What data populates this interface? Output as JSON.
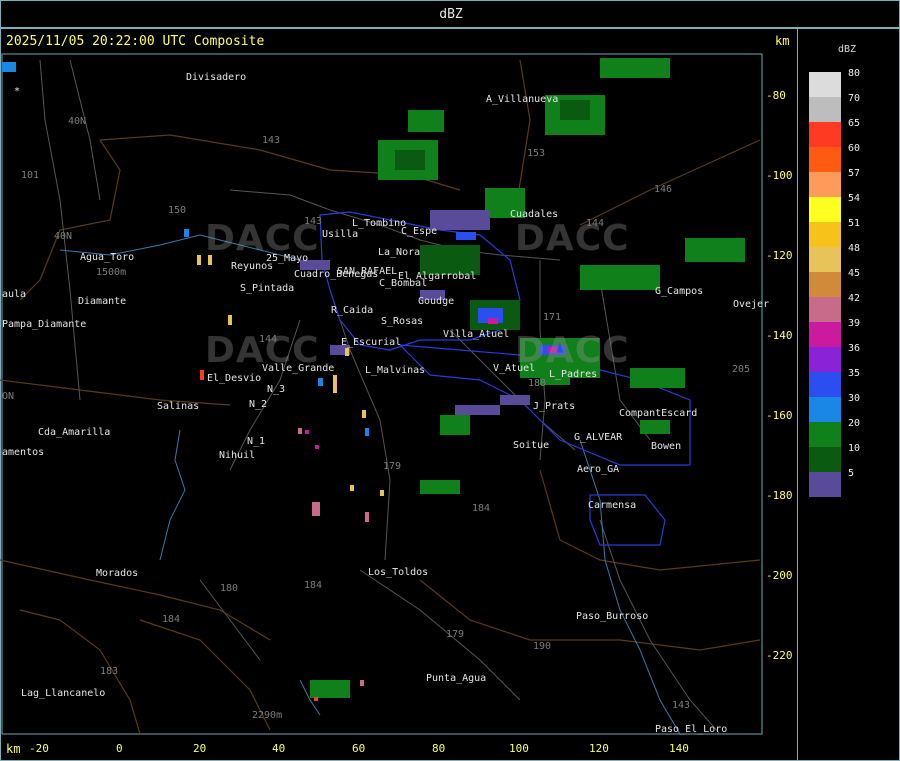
{
  "header": {
    "title": "dBZ"
  },
  "map": {
    "timestamp": "2025/11/05 20:22:00 UTC Composite",
    "km_label_top": "km",
    "km_label_bottom": "km",
    "y_ticks": [
      "-80",
      "-100",
      "-120",
      "-140",
      "-160",
      "-180",
      "-200",
      "-220"
    ],
    "x_ticks": [
      "-20",
      "0",
      "20",
      "40",
      "60",
      "80",
      "100",
      "120",
      "140"
    ],
    "watermark": "DACC",
    "places": [
      {
        "name": "Divisadero"
      },
      {
        "name": "A_Villanueva"
      },
      {
        "name": "Cuadales"
      },
      {
        "name": "L_Tombino"
      },
      {
        "name": "Usilla"
      },
      {
        "name": "C_Espe"
      },
      {
        "name": "Agua_Toro"
      },
      {
        "name": "Reyunos"
      },
      {
        "name": "25_Mayo"
      },
      {
        "name": "La_Nora"
      },
      {
        "name": "Cuadro_Benegas"
      },
      {
        "name": "SAN_RAFAEL"
      },
      {
        "name": "El_Algarrobal"
      },
      {
        "name": "Goudge"
      },
      {
        "name": "Villa_Atuel"
      },
      {
        "name": "G_Campos"
      },
      {
        "name": "Ovejer"
      },
      {
        "name": "Pampa_Diamante"
      },
      {
        "name": "S_Pintada"
      },
      {
        "name": "C_Bombal"
      },
      {
        "name": "R_Caida"
      },
      {
        "name": "S_Rosas"
      },
      {
        "name": "E_Escurial"
      },
      {
        "name": "L_Malvinas"
      },
      {
        "name": "V_Atuel"
      },
      {
        "name": "L_Padres"
      },
      {
        "name": "El_Desvio"
      },
      {
        "name": "Valle_Grande"
      },
      {
        "name": "N_3"
      },
      {
        "name": "N_2"
      },
      {
        "name": "N_1"
      },
      {
        "name": "Salinas"
      },
      {
        "name": "J_Prats"
      },
      {
        "name": "CompantEscard"
      },
      {
        "name": "Cda_Amarilla"
      },
      {
        "name": "Nihuil"
      },
      {
        "name": "G_ALVEAR"
      },
      {
        "name": "Bowen"
      },
      {
        "name": "Soitue"
      },
      {
        "name": "Aero_GA"
      },
      {
        "name": "Carmensa"
      },
      {
        "name": "Morados"
      },
      {
        "name": "Los_Toldos"
      },
      {
        "name": "Paso_Burroso"
      },
      {
        "name": "Punta_Agua"
      },
      {
        "name": "Lag_Llancanelo"
      },
      {
        "name": "Paso_El_Loro"
      },
      {
        "name": "aula"
      },
      {
        "name": "amentos"
      },
      {
        "name": "Diamante"
      },
      {
        "name": "*"
      }
    ],
    "roads": [
      "143",
      "40N",
      "101",
      "150",
      "143",
      "153",
      "146",
      "144",
      "40N",
      "144",
      "171",
      "188",
      "179",
      "184",
      "180",
      "184",
      "184",
      "183",
      "179",
      "190",
      "143",
      "205",
      "1500m",
      "2290m",
      "ON"
    ]
  },
  "legend": {
    "title": "dBZ",
    "levels": [
      {
        "label": "80",
        "color": "#dcdcdc"
      },
      {
        "label": "70",
        "color": "#bdbdbd"
      },
      {
        "label": "65",
        "color": "#ff3a22"
      },
      {
        "label": "60",
        "color": "#ff5a12"
      },
      {
        "label": "57",
        "color": "#ff9a5a"
      },
      {
        "label": "54",
        "color": "#ffff20"
      },
      {
        "label": "51",
        "color": "#f7c21a"
      },
      {
        "label": "48",
        "color": "#e8c35a"
      },
      {
        "label": "45",
        "color": "#d08a3a"
      },
      {
        "label": "42",
        "color": "#c86a8a"
      },
      {
        "label": "39",
        "color": "#cc1aa0"
      },
      {
        "label": "36",
        "color": "#8a22d8"
      },
      {
        "label": "35",
        "color": "#2a4ef0"
      },
      {
        "label": "30",
        "color": "#1a86e6"
      },
      {
        "label": "20",
        "color": "#10801a"
      },
      {
        "label": "10",
        "color": "#0a5a12"
      },
      {
        "label": "5",
        "color": "#5a4a9a"
      }
    ]
  }
}
